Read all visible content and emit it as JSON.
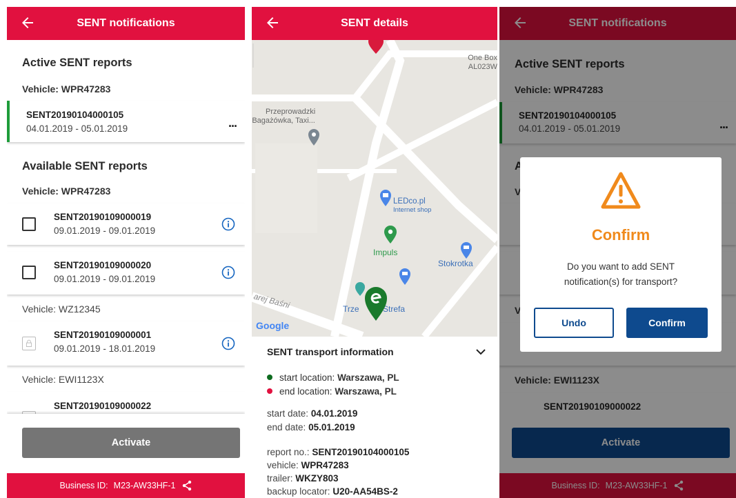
{
  "colors": {
    "brand_red": "#e1113f",
    "active_green": "#1e9c3a",
    "button_gray": "#757575",
    "primary_blue": "#0e4a8e",
    "warning_orange": "#f08a1c",
    "info_blue": "#1565c0"
  },
  "screen1": {
    "appbar_title": "SENT notifications",
    "active_section_title": "Active SENT reports",
    "active_vehicle": "Vehicle: WPR47283",
    "active_report": {
      "code": "SENT20190104000105",
      "dates": "04.01.2019 - 05.01.2019",
      "more": "..."
    },
    "available_section_title": "Available SENT reports",
    "groups": [
      {
        "vehicle": "Vehicle: WPR47283",
        "items": [
          {
            "code": "SENT20190109000019",
            "dates": "09.01.2019 - 09.01.2019"
          },
          {
            "code": "SENT20190109000020",
            "dates": "09.01.2019 - 09.01.2019"
          }
        ]
      },
      {
        "vehicle": "Vehicle: WZ12345",
        "items": [
          {
            "code": "SENT20190109000001",
            "dates": "09.01.2019 - 18.01.2019"
          }
        ]
      },
      {
        "vehicle": "Vehicle: EWI1123X",
        "items": [
          {
            "code": "SENT20190109000022",
            "dates": ""
          }
        ]
      }
    ],
    "activate_label": "Activate",
    "footer_label": "Business ID:",
    "footer_value": "M23-AW33HF-1"
  },
  "screen2": {
    "appbar_title": "SENT details",
    "map_labels": {
      "one_box": "One Box",
      "al023": "AL023W",
      "przeprowadzki_1": "Przeprowadzki",
      "przeprowadzki_2": "Bagażówka, Taxi...",
      "ledco": "LEDco.pl",
      "ledco_sub": "Internet shop",
      "impuls": "Impuls",
      "stokrotka": "Stokrotka",
      "street": "arej Baśni",
      "trzecia_1": "Trze",
      "trzecia_2": "Strefa",
      "google": "Google"
    },
    "info_title": "SENT transport information",
    "start_location_label": "start location:",
    "start_location_value": "Warszawa, PL",
    "end_location_label": "end location:",
    "end_location_value": "Warszawa, PL",
    "start_date_label": "start date:",
    "start_date_value": "04.01.2019",
    "end_date_label": "end date:",
    "end_date_value": "05.01.2019",
    "report_no_label": "report no.:",
    "report_no_value": "SENT20190104000105",
    "vehicle_label": "vehicle:",
    "vehicle_value": "WPR47283",
    "trailer_label": "trailer:",
    "trailer_value": "WKZY803",
    "backup_label": "backup locator:",
    "backup_value": "U20-AA54BS-2"
  },
  "screen3": {
    "appbar_title": "SENT notifications",
    "active_section_title": "Active SENT reports",
    "active_vehicle": "Vehicle: WPR47283",
    "active_report": {
      "code": "SENT20190104000105",
      "dates": "04.01.2019 - 05.01.2019",
      "more": "..."
    },
    "partial_available": "A",
    "partial_vehicle_1": "V",
    "partial_vehicle_2": "V",
    "bottom_vehicle": "Vehicle: EWI1123X",
    "bottom_code": "SENT20190109000022",
    "activate_label": "Activate",
    "footer_label": "Business ID:",
    "footer_value": "M23-AW33HF-1",
    "dialog": {
      "title": "Confirm",
      "message": "Do you want to add SENT notification(s) for transport?",
      "undo_label": "Undo",
      "confirm_label": "Confirm"
    }
  }
}
